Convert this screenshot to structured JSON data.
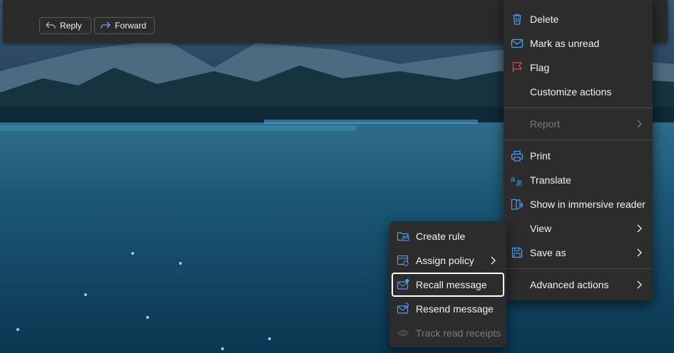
{
  "toolbar": {
    "reply_label": "Reply",
    "forward_label": "Forward"
  },
  "main_menu": {
    "items": [
      {
        "label": "Delete",
        "icon": "trash-icon"
      },
      {
        "label": "Mark as unread",
        "icon": "envelope-icon"
      },
      {
        "label": "Flag",
        "icon": "flag-icon"
      },
      {
        "label": "Customize actions",
        "icon": ""
      },
      {
        "label": "Report",
        "icon": "",
        "disabled": true,
        "submenu": true
      },
      {
        "label": "Print",
        "icon": "printer-icon"
      },
      {
        "label": "Translate",
        "icon": "translate-icon"
      },
      {
        "label": "Show in immersive reader",
        "icon": "immersive-reader-icon"
      },
      {
        "label": "View",
        "icon": "",
        "submenu": true
      },
      {
        "label": "Save as",
        "icon": "save-icon",
        "submenu": true
      },
      {
        "label": "Advanced actions",
        "icon": "",
        "submenu": true
      }
    ]
  },
  "sub_menu": {
    "items": [
      {
        "label": "Create rule",
        "icon": "folder-rule-icon"
      },
      {
        "label": "Assign policy",
        "icon": "policy-icon",
        "submenu": true
      },
      {
        "label": "Recall message",
        "icon": "recall-icon",
        "focused": true
      },
      {
        "label": "Resend message",
        "icon": "resend-icon"
      },
      {
        "label": "Track read receipts",
        "icon": "eye-icon",
        "disabled": true
      }
    ]
  },
  "colors": {
    "menu_bg": "#2c2c2c",
    "accent_blue": "#4c9df0",
    "flag_red": "#e0474b",
    "disabled_text": "#7a7a7a"
  }
}
